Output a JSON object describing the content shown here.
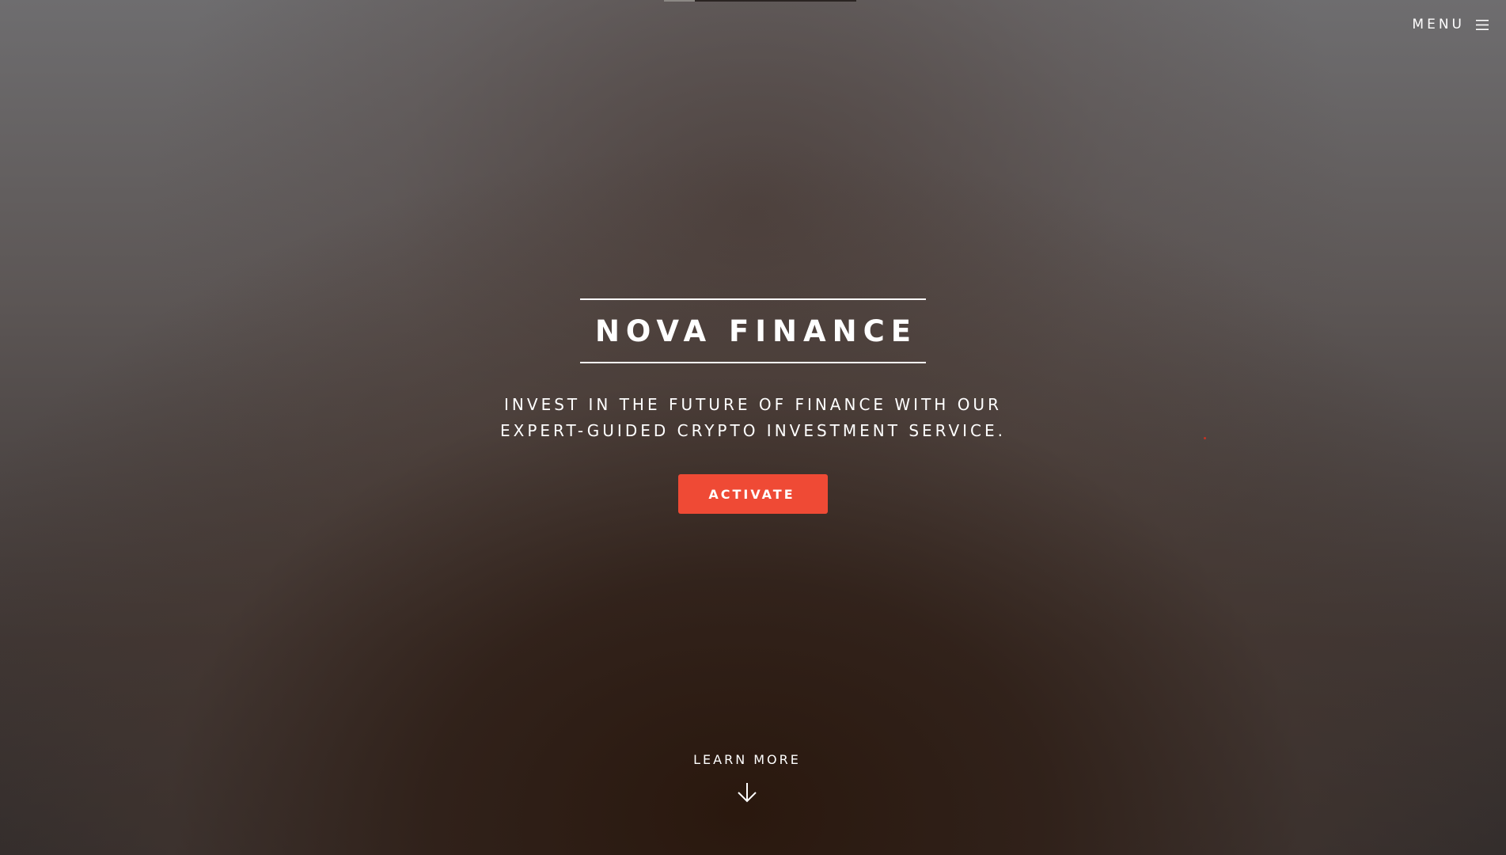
{
  "header": {
    "menu_label": "MENU",
    "menu_icon": "hamburger-icon",
    "scroll_progress": 0.16
  },
  "hero": {
    "title": "NOVA FINANCE",
    "tagline_line1": "INVEST IN THE FUTURE OF FINANCE WITH OUR",
    "tagline_line2": "EXPERT-GUIDED CRYPTO INVESTMENT SERVICE.",
    "cta_label": "ACTIVATE"
  },
  "footer_cta": {
    "label": "LEARN MORE",
    "icon": "arrow-down-icon"
  },
  "colors": {
    "accent": "#ef4a35",
    "text": "#ffffff",
    "background_dark": "#2a1a12",
    "background_light": "#6e6d6f"
  }
}
